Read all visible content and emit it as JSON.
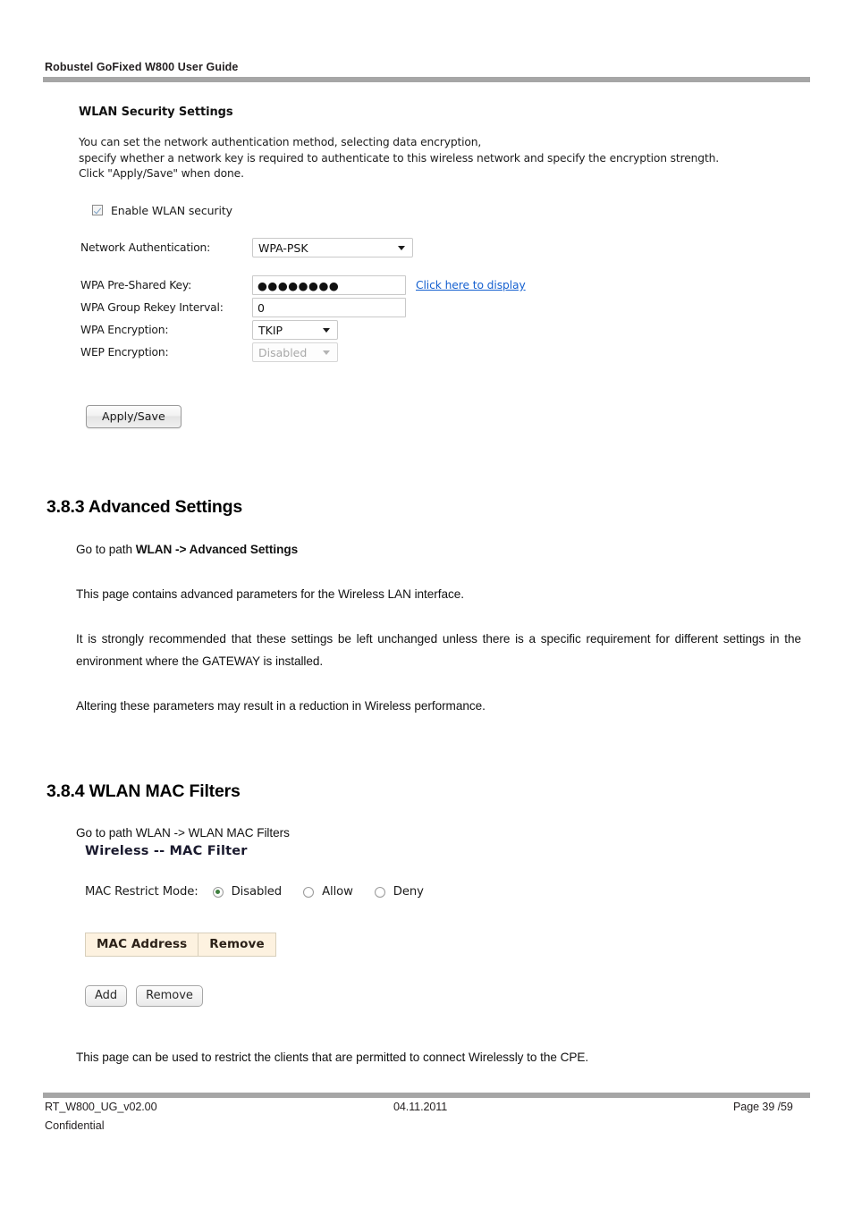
{
  "header": {
    "running_title": "Robustel GoFixed W800 User Guide"
  },
  "security_screenshot": {
    "title": "WLAN Security Settings",
    "description_lines": [
      "You can set the network authentication method, selecting data encryption,",
      "specify whether a network key is required to authenticate to this wireless network and specify the encryption strength.",
      "Click \"Apply/Save\" when done."
    ],
    "enable_checkbox_label": "Enable WLAN security",
    "enable_checkbox_checked": "true",
    "fields": {
      "network_auth_label": "Network Authentication:",
      "network_auth_value": "WPA-PSK",
      "psk_label": "WPA Pre-Shared Key:",
      "psk_value": "●●●●●●●●",
      "psk_link": "Click here to display",
      "rekey_label": "WPA Group Rekey Interval:",
      "rekey_value": "0",
      "wpa_enc_label": "WPA Encryption:",
      "wpa_enc_value": "TKIP",
      "wep_enc_label": "WEP Encryption:",
      "wep_enc_value": "Disabled"
    },
    "apply_button": "Apply/Save"
  },
  "section_383": {
    "heading": "3.8.3 Advanced Settings",
    "path_prefix": "Go to path ",
    "path_bold": "WLAN -> Advanced Settings",
    "paragraph_1": "This page contains advanced parameters for the Wireless LAN interface.",
    "paragraph_2": "It is strongly recommended that these settings be left unchanged unless there is a specific requirement for different settings in the environment where the GATEWAY is installed.",
    "paragraph_3": "Altering these parameters may result in a reduction in Wireless performance."
  },
  "section_384": {
    "heading": "3.8.4 WLAN MAC Filters",
    "path_text": "Go to path WLAN -> WLAN MAC Filters",
    "closing_paragraph": "This page can be used to restrict the clients that are permitted to connect Wirelessly to the CPE."
  },
  "mac_screenshot": {
    "title": "Wireless -- MAC Filter",
    "restrict_mode_label": "MAC Restrict Mode:",
    "restrict_options": [
      {
        "label": "Disabled",
        "selected": "true"
      },
      {
        "label": "Allow",
        "selected": "false"
      },
      {
        "label": "Deny",
        "selected": "false"
      }
    ],
    "table_headers": [
      "MAC Address",
      "Remove"
    ],
    "add_button": "Add",
    "remove_button": "Remove"
  },
  "footer": {
    "doc_id": "RT_W800_UG_v02.00",
    "date": "04.11.2011",
    "page": "Page 39 /59",
    "confidentiality": "Confidential"
  },
  "colors": {
    "rule_gray": "#a6a6a6",
    "link_blue": "#1560d0",
    "table_cream": "#fdf2e0",
    "radio_green": "#3f7f3f"
  }
}
